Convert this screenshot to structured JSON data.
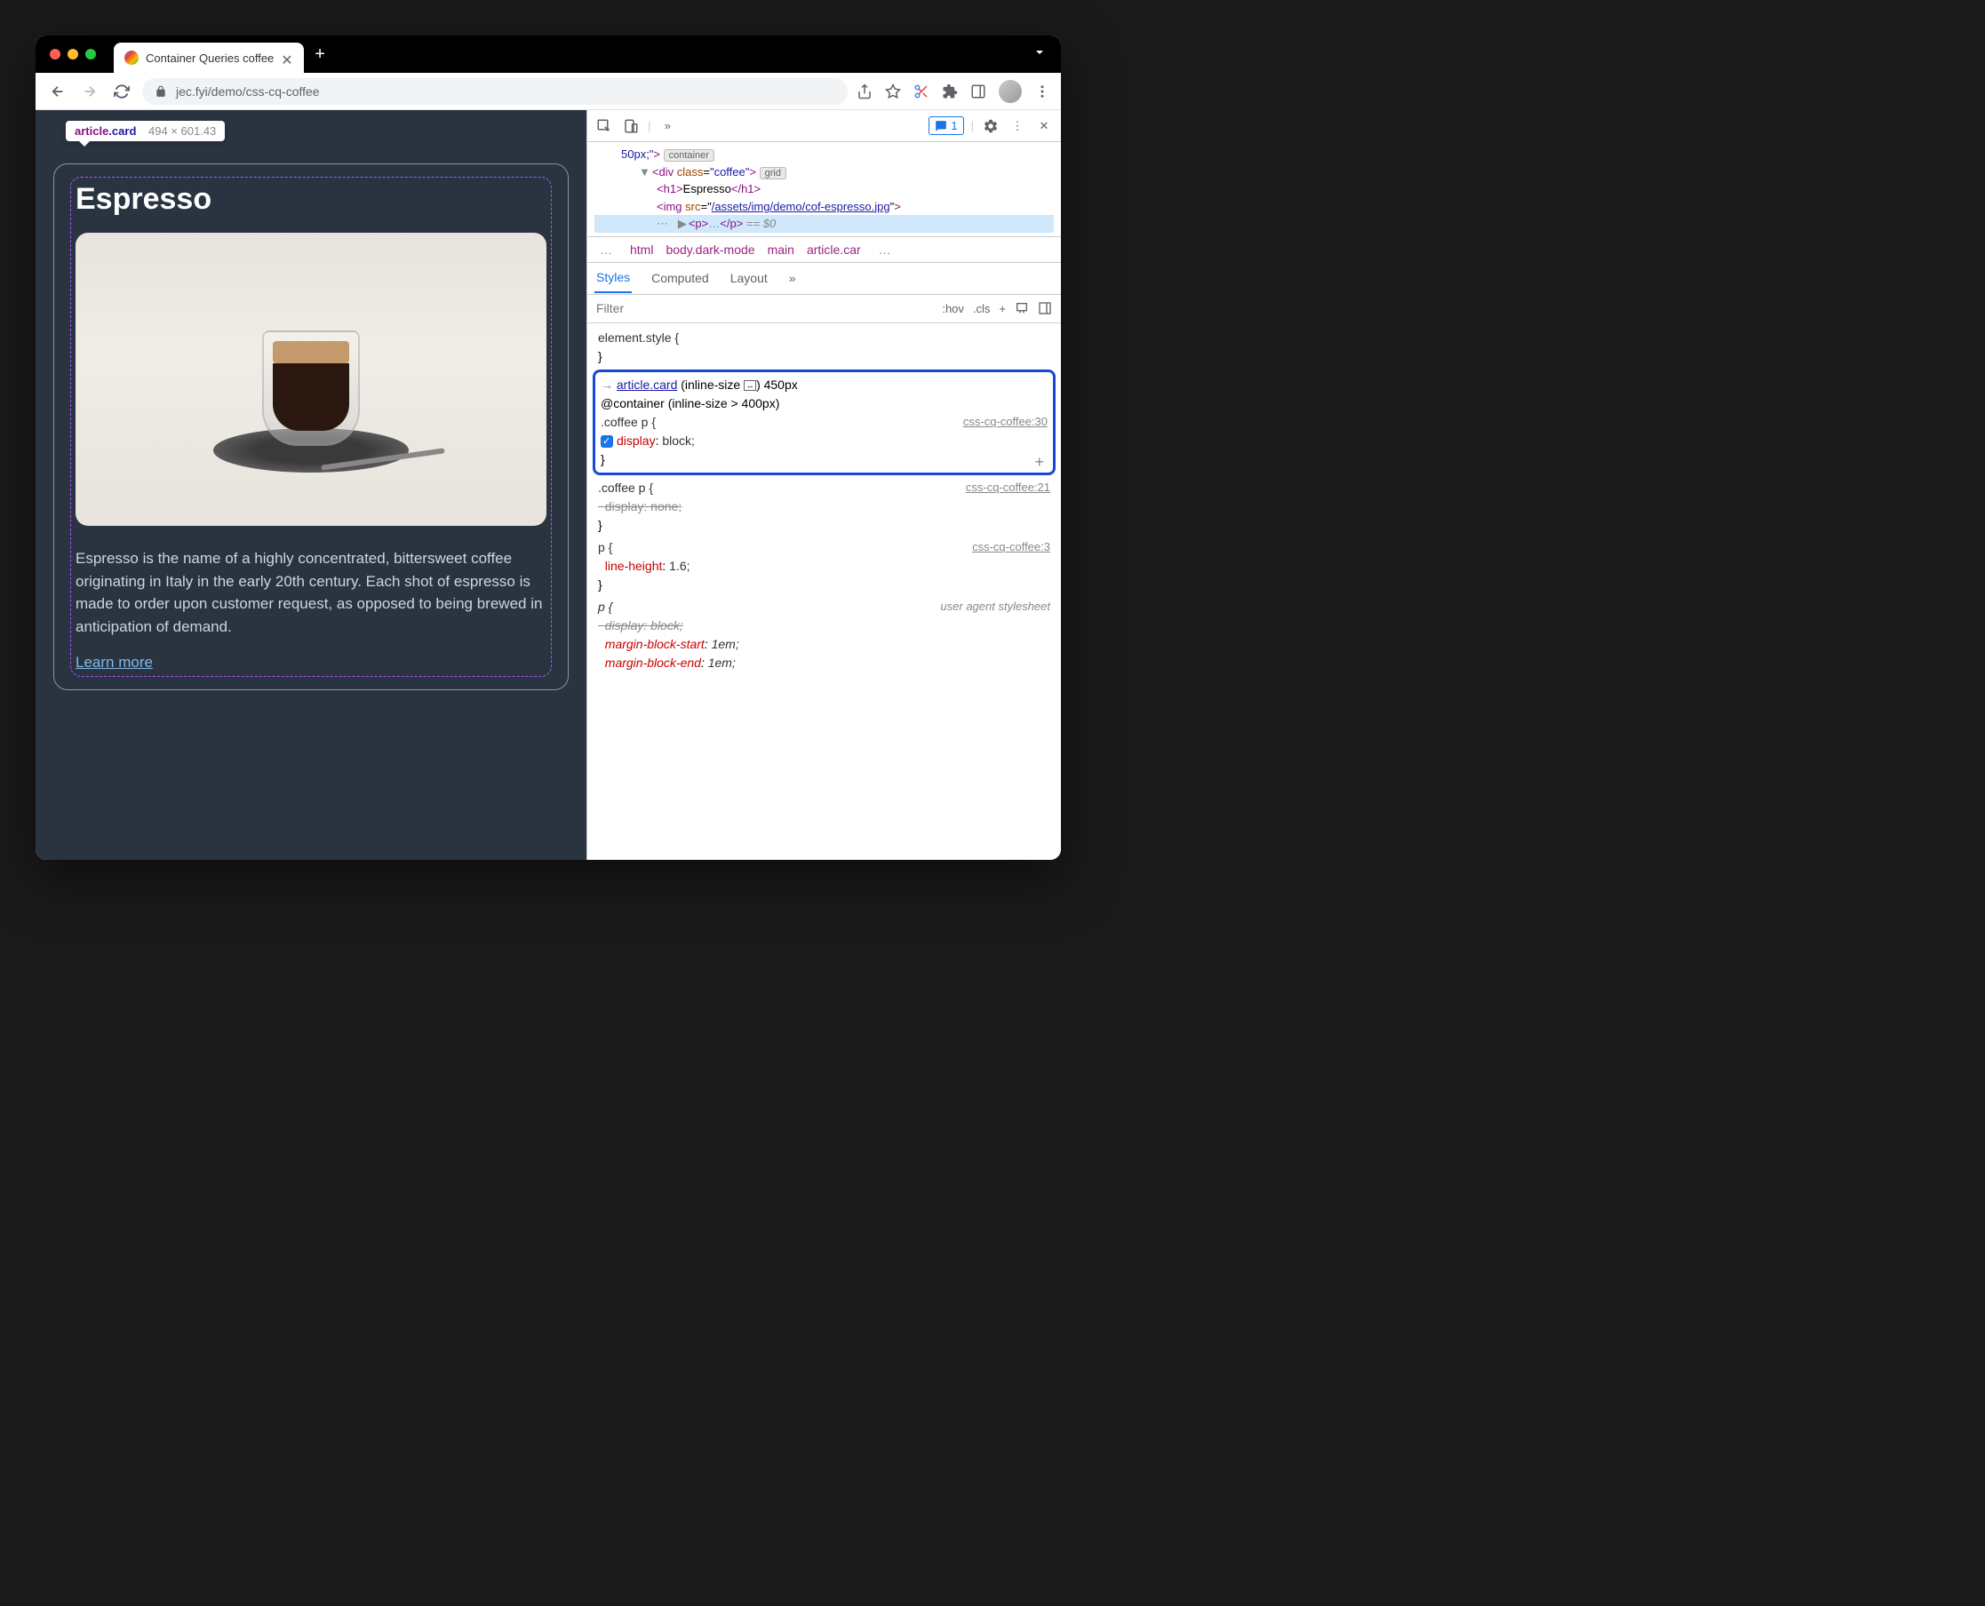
{
  "tab": {
    "title": "Container Queries coffee"
  },
  "url": "jec.fyi/demo/css-cq-coffee",
  "inspect": {
    "tag": "article",
    "class": ".card",
    "dims": "494 × 601.43"
  },
  "card": {
    "title": "Espresso",
    "text": "Espresso is the name of a highly concentrated, bittersweet coffee originating in Italy in the early 20th century. Each shot of espresso is made to order upon customer request, as opposed to being brewed in anticipation of demand.",
    "link": "Learn more"
  },
  "devtools": {
    "issues_count": "1",
    "elements": {
      "line1_text": "50px;\"",
      "line1_badge": "container",
      "div_class": "coffee",
      "div_badge": "grid",
      "h1_text": "Espresso",
      "img_src": "/assets/img/demo/cof-espresso.jpg",
      "p_selected": "…",
      "dollar": "== $0"
    },
    "breadcrumb": [
      "…",
      "html",
      "body.dark-mode",
      "main",
      "article.car",
      "…"
    ],
    "styles_tabs": [
      "Styles",
      "Computed",
      "Layout",
      "»"
    ],
    "filter_placeholder": "Filter",
    "hov": ":hov",
    "cls": ".cls",
    "rules": {
      "element_style": "element.style {",
      "r1": {
        "container_link": "article.card",
        "container_text": "(inline-size",
        "container_size": ") 450px",
        "at": "@container (inline-size > 400px)",
        "selector": ".coffee p {",
        "source": "css-cq-coffee:30",
        "prop": "display",
        "val": "block;"
      },
      "r2": {
        "selector": ".coffee p {",
        "source": "css-cq-coffee:21",
        "prop": "display",
        "val": "none;"
      },
      "r3": {
        "selector": "p {",
        "source": "css-cq-coffee:3",
        "prop": "line-height",
        "val": "1.6;"
      },
      "r4": {
        "selector": "p {",
        "source": "user agent stylesheet",
        "p1n": "display",
        "p1v": "block;",
        "p2n": "margin-block-start",
        "p2v": "1em;",
        "p3n": "margin-block-end",
        "p3v": "1em;"
      }
    }
  }
}
